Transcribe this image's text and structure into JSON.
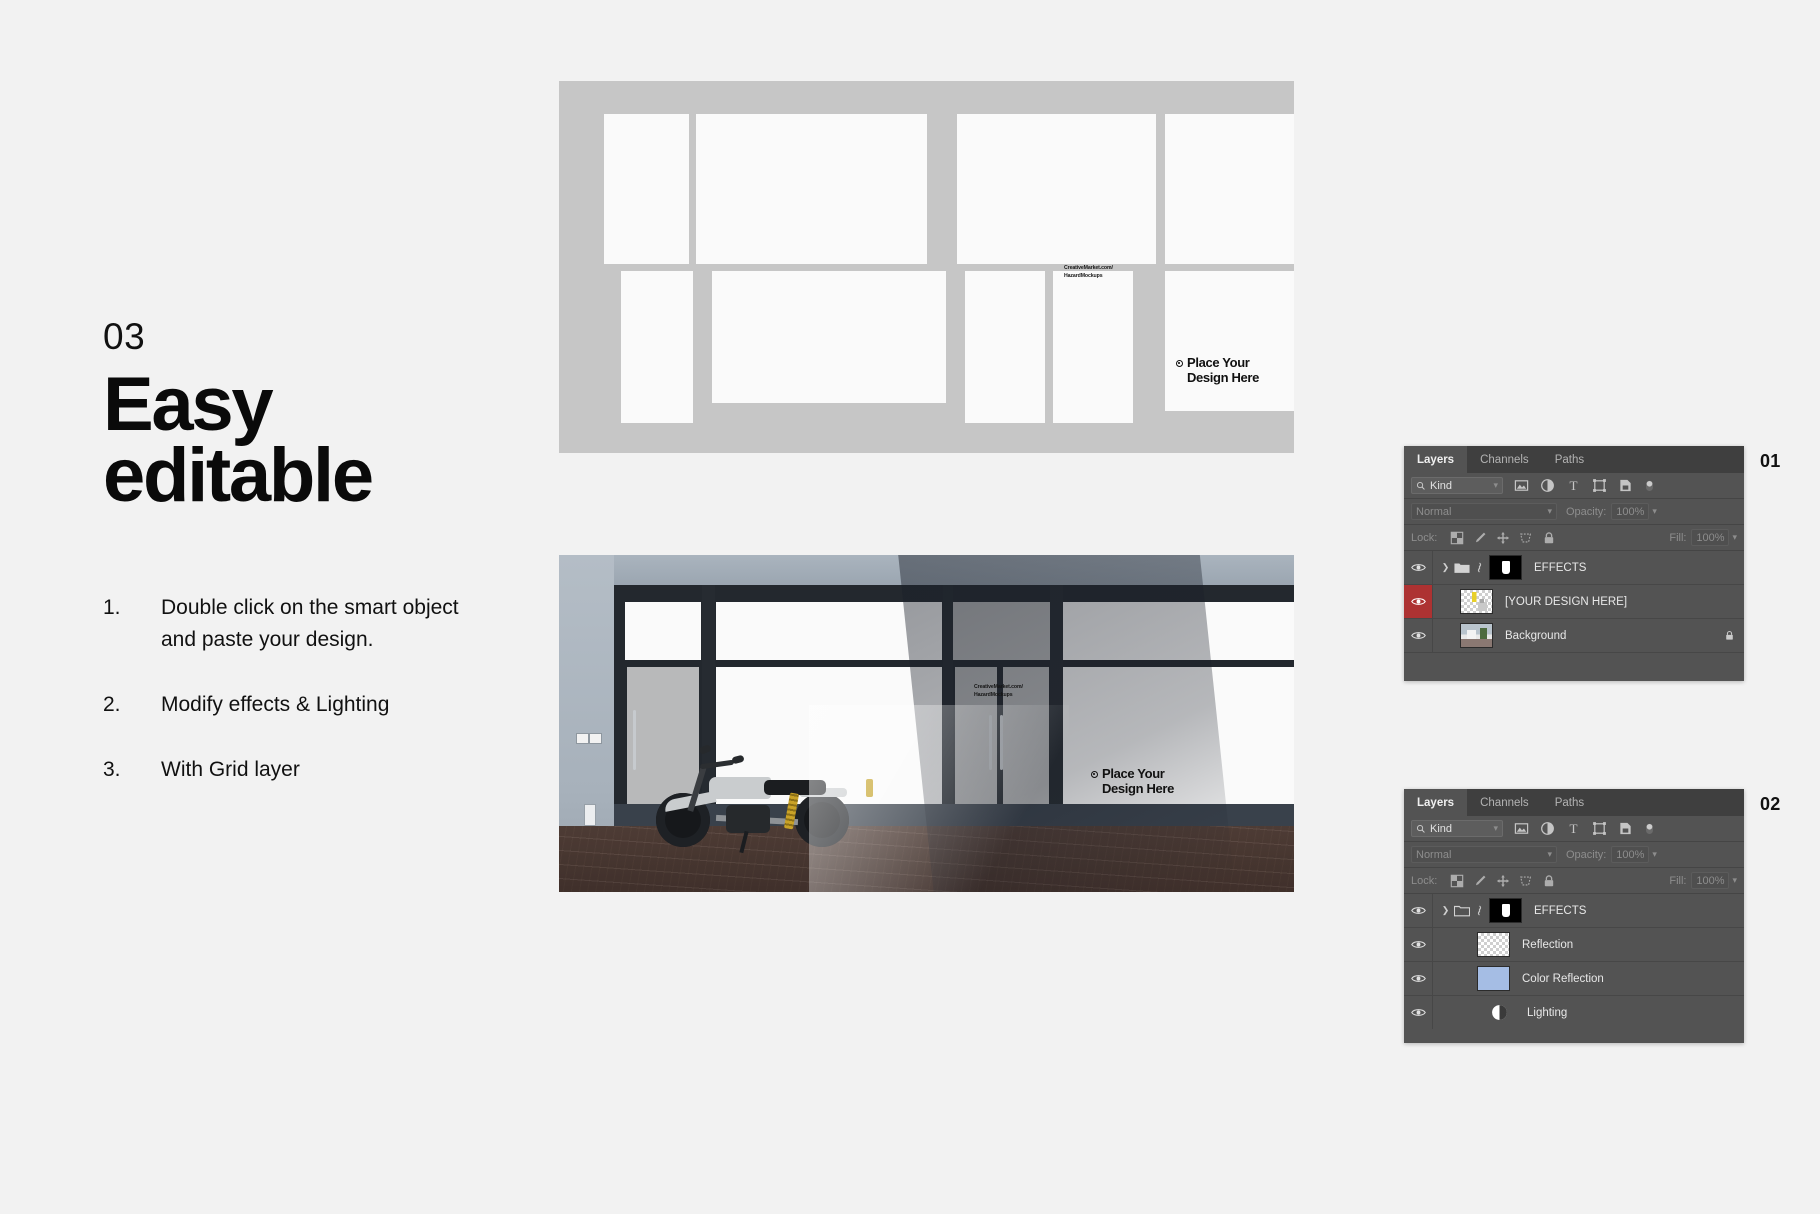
{
  "slide": {
    "step_number": "03",
    "headline_line1": "Easy",
    "headline_line2": "editable",
    "steps": [
      {
        "index": "1.",
        "text": "Double click on the smart object and paste your design."
      },
      {
        "index": "2.",
        "text": "Modify effects & Lighting"
      },
      {
        "index": "3.",
        "text": "With Grid layer"
      }
    ]
  },
  "mockup": {
    "watermark": "CreativeMarket.com/\nHazardMockups",
    "placeholder": "Place Your\nDesign Here",
    "grid_bg_color": "#c6c6c6",
    "cell_color": "#fafafa"
  },
  "panels": [
    {
      "index_label": "01",
      "tabs": [
        "Layers",
        "Channels",
        "Paths"
      ],
      "active_tab": "Layers",
      "filter": {
        "label": "Kind",
        "icon": "search-icon"
      },
      "filter_icons": [
        "pixel-layer-icon",
        "adjustment-layer-icon",
        "type-layer-icon",
        "shape-layer-icon",
        "smart-object-icon",
        "filter-toggle-icon"
      ],
      "blend_mode": "Normal",
      "opacity_label": "Opacity:",
      "opacity_value": "100%",
      "lock_label": "Lock:",
      "lock_icons": [
        "lock-transparent-pixels-icon",
        "lock-image-pixels-icon",
        "lock-position-icon",
        "lock-artboard-nesting-icon",
        "lock-all-icon"
      ],
      "fill_label": "Fill:",
      "fill_value": "100%",
      "layers": [
        {
          "name": "EFFECTS",
          "type": "group",
          "expanded": false,
          "visible": true,
          "linked": true,
          "has_mask": true,
          "selected": false,
          "locked": false,
          "eye_highlight": false
        },
        {
          "name": "[YOUR DESIGN HERE]",
          "type": "smart-object",
          "visible": true,
          "selected": false,
          "locked": false,
          "eye_highlight": true
        },
        {
          "name": "Background",
          "type": "image",
          "visible": true,
          "selected": false,
          "locked": true,
          "eye_highlight": false
        }
      ]
    },
    {
      "index_label": "02",
      "tabs": [
        "Layers",
        "Channels",
        "Paths"
      ],
      "active_tab": "Layers",
      "filter": {
        "label": "Kind",
        "icon": "search-icon"
      },
      "filter_icons": [
        "pixel-layer-icon",
        "adjustment-layer-icon",
        "type-layer-icon",
        "shape-layer-icon",
        "smart-object-icon",
        "filter-toggle-icon"
      ],
      "blend_mode": "Normal",
      "opacity_label": "Opacity:",
      "opacity_value": "100%",
      "lock_label": "Lock:",
      "lock_icons": [
        "lock-transparent-pixels-icon",
        "lock-image-pixels-icon",
        "lock-position-icon",
        "lock-artboard-nesting-icon",
        "lock-all-icon"
      ],
      "fill_label": "Fill:",
      "fill_value": "100%",
      "layers": [
        {
          "name": "EFFECTS",
          "type": "group",
          "expanded": true,
          "visible": true,
          "linked": true,
          "has_mask": true,
          "selected": false,
          "locked": false,
          "eye_highlight": false
        },
        {
          "name": "Reflection",
          "type": "transparent",
          "visible": true,
          "selected": false,
          "locked": false,
          "eye_highlight": false
        },
        {
          "name": "Color Reflection",
          "type": "color",
          "color": "#a5bde4",
          "visible": true,
          "selected": false,
          "locked": false,
          "eye_highlight": false
        },
        {
          "name": "Lighting",
          "type": "adjustment",
          "visible": true,
          "selected": false,
          "locked": false,
          "eye_highlight": false
        }
      ]
    }
  ],
  "colors": {
    "page_bg": "#f2f2f2",
    "panel_bg": "#535353",
    "panel_tab_bg": "#3f3f3f",
    "panel_text": "#e8e8e8",
    "eye_highlight": "#ad3232",
    "accent_blue": "#a5bde4"
  }
}
